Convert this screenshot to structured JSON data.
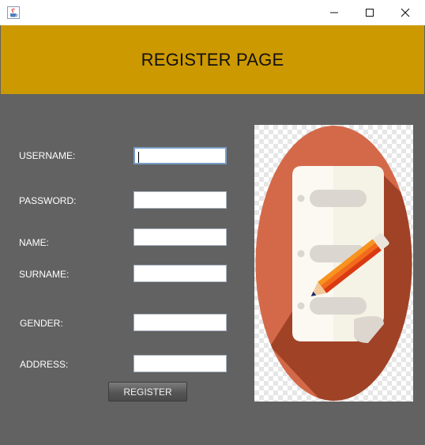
{
  "window": {
    "app_icon": "java-cup-icon",
    "controls": [
      "minimize-icon",
      "maximize-icon",
      "close-icon"
    ]
  },
  "header": {
    "title": "REGISTER PAGE",
    "background": "#cc9900"
  },
  "form": {
    "fields": [
      {
        "label": "USERNAME:",
        "value": "",
        "focused": true
      },
      {
        "label": "PASSWORD:",
        "value": ""
      },
      {
        "label": "NAME:",
        "value": ""
      },
      {
        "label": "SURNAME:",
        "value": ""
      },
      {
        "label": "GENDER:",
        "value": ""
      },
      {
        "label": "ADDRESS:",
        "value": ""
      }
    ],
    "submit_label": "REGISTER"
  },
  "illustration": {
    "icon": "notepad-pencil-icon",
    "colors": {
      "circle": "#d4694a",
      "shadow": "#9a3e22",
      "paper": "#f4f0e6",
      "pencil": "#f26b1d"
    }
  },
  "theme": {
    "panel_background": "#626262",
    "label_color": "#ffffff"
  }
}
